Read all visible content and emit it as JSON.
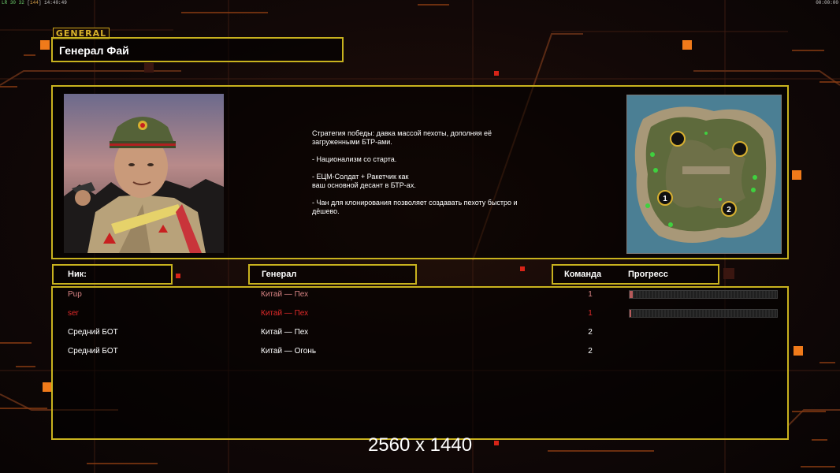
{
  "hud": {
    "fps_label": "LR",
    "fps_value": "30",
    "fps_alt": "32",
    "fps_extra": "144",
    "time": "14:40:49",
    "clock": "00:00:00"
  },
  "header": {
    "tag": "GENERAL",
    "title": "Генерал Фай"
  },
  "strategy": {
    "paragraphs": [
      "Стратегия победы: давка массой пехоты, дополняя её\n загруженными БТР-ами.",
      "- Национализм со старта.",
      "- ЕЦМ-Солдат + Ракетчик как\nваш основной десант в БТР-ах.",
      "- Чан для клонирования позволяет создавать пехоту быстро и\n дёшево."
    ]
  },
  "minimap": {
    "start_positions": [
      "1",
      "2"
    ]
  },
  "table": {
    "col_nick": "Ник:",
    "col_general": "Генерал",
    "col_team": "Команда",
    "col_progress": "Прогресс",
    "rows": [
      {
        "nick": "Pup",
        "army": "Китай — Пех",
        "team": "1",
        "color": "#d98484",
        "progress": 0.02,
        "has_progress": true
      },
      {
        "nick": "ser",
        "army": "Китай — Пех",
        "team": "1",
        "color": "#e02a2a",
        "progress": 0.01,
        "has_progress": true
      },
      {
        "nick": "Средний БОТ",
        "army": "Китай — Пех",
        "team": "2",
        "color": "#ffffff",
        "progress": 0,
        "has_progress": false
      },
      {
        "nick": "Средний БОТ",
        "army": "Китай — Огонь",
        "team": "2",
        "color": "#ffffff",
        "progress": 0,
        "has_progress": false
      }
    ]
  },
  "resolution_label": "2560 x 1440",
  "colors": {
    "frame": "#c8b21e",
    "accent_orange": "#f07a1a",
    "accent_red": "#d82418"
  }
}
